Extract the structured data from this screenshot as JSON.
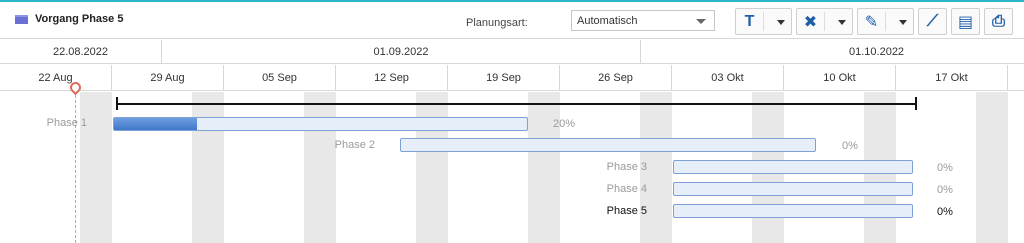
{
  "toolbar": {
    "title": "Vorgang Phase 5",
    "planning_label": "Planungsart:",
    "planning_value": "Automatisch",
    "buttons": [
      {
        "name": "text-tool-button",
        "glyph": "T"
      },
      {
        "name": "delete-button",
        "glyph": "✖"
      },
      {
        "name": "edit-button",
        "glyph": "✎"
      },
      {
        "name": "link-button",
        "glyph": "⟋"
      },
      {
        "name": "export-button",
        "glyph": "▤"
      },
      {
        "name": "print-button",
        "glyph": "⎙"
      }
    ],
    "accent_color": "#1f5fa8"
  },
  "header": {
    "row1": [
      "22.08.2022",
      "01.09.2022",
      "01.10.2022"
    ],
    "row2": [
      "22 Aug",
      "29 Aug",
      "05 Sep",
      "12 Sep",
      "19 Sep",
      "26 Sep",
      "03 Okt",
      "10 Okt",
      "17 Okt"
    ]
  },
  "phases": [
    {
      "label": "Phase 1",
      "progress": 0.2,
      "progress_text": "20%"
    },
    {
      "label": "Phase 2",
      "progress": 0.0,
      "progress_text": "0%"
    },
    {
      "label": "Phase 3",
      "progress": 0.0,
      "progress_text": "0%"
    },
    {
      "label": "Phase 4",
      "progress": 0.0,
      "progress_text": "0%"
    },
    {
      "label": "Phase 5",
      "progress": 0.0,
      "progress_text": "0%"
    }
  ]
}
